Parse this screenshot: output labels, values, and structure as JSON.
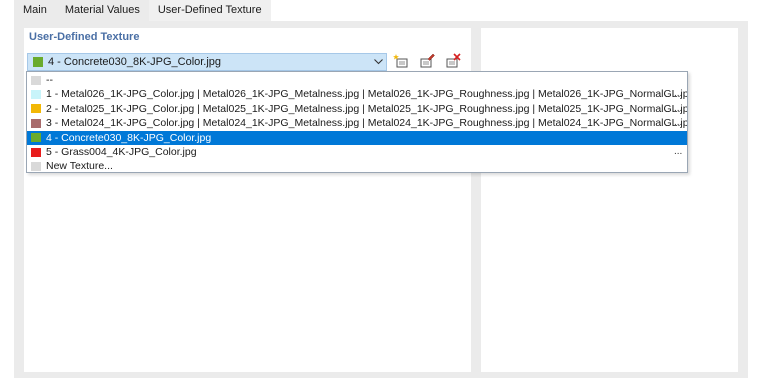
{
  "tabs": [
    {
      "label": "Main"
    },
    {
      "label": "Material Values"
    },
    {
      "label": "User-Defined Texture"
    }
  ],
  "section": {
    "title": "User-Defined Texture"
  },
  "combo": {
    "value": "4 - Concrete030_8K-JPG_Color.jpg",
    "swatch_color": "#6aab2c"
  },
  "toolbar": {
    "new_icon": "new-texture-icon",
    "edit_icon": "edit-texture-icon",
    "delete_icon": "delete-texture-icon"
  },
  "dropdown": {
    "items": [
      {
        "label": "--",
        "color": "#d9d9d9",
        "more": ""
      },
      {
        "label": "1 - Metal026_1K-JPG_Color.jpg | Metal026_1K-JPG_Metalness.jpg | Metal026_1K-JPG_Roughness.jpg | Metal026_1K-JPG_NormalGL.jpg",
        "color": "#c8f4fa",
        "more": "..."
      },
      {
        "label": "2 - Metal025_1K-JPG_Color.jpg | Metal025_1K-JPG_Metalness.jpg | Metal025_1K-JPG_Roughness.jpg | Metal025_1K-JPG_NormalGL.jpg",
        "color": "#f2b705",
        "more": "..."
      },
      {
        "label": "3 - Metal024_1K-JPG_Color.jpg | Metal024_1K-JPG_Metalness.jpg | Metal024_1K-JPG_Roughness.jpg | Metal024_1K-JPG_NormalGL.jpg",
        "color": "#a86b6b",
        "more": "..."
      },
      {
        "label": "4 - Concrete030_8K-JPG_Color.jpg",
        "color": "#6aab2c",
        "more": "",
        "selected": true
      },
      {
        "label": "5 - Grass004_4K-JPG_Color.jpg",
        "color": "#e81c1c",
        "more": "..."
      },
      {
        "label": "New Texture...",
        "color": "#d9d9d9",
        "more": ""
      }
    ]
  },
  "colors": {
    "selection": "#0078d7",
    "combo_bg": "#cce4f7",
    "section_title": "#4a6fa5"
  }
}
